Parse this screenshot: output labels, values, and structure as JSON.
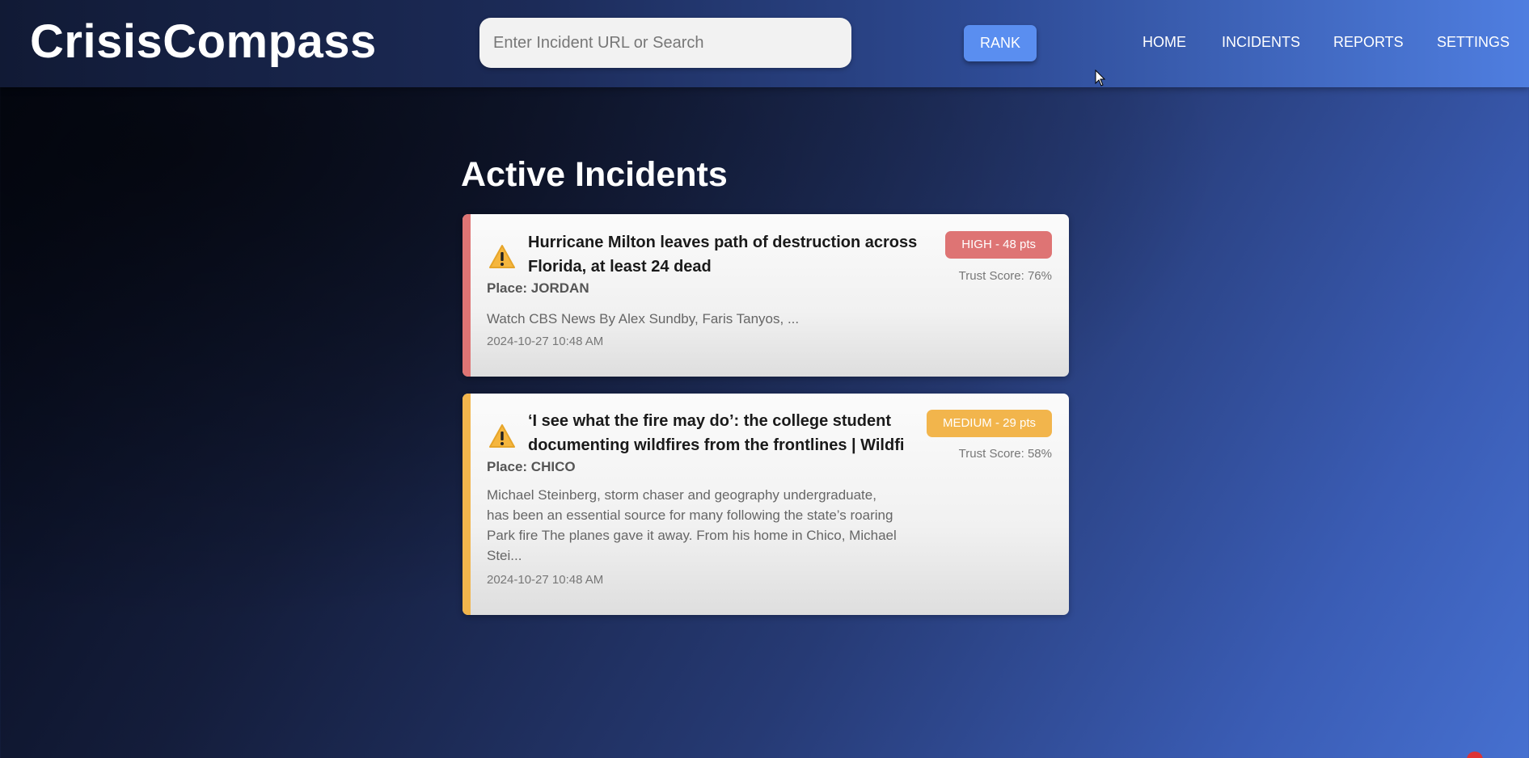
{
  "app": {
    "logo": "CrisisCompass"
  },
  "search": {
    "placeholder": "Enter Incident URL or Search"
  },
  "toolbar": {
    "rank_label": "RANK"
  },
  "nav": {
    "items": [
      {
        "label": "HOME"
      },
      {
        "label": "INCIDENTS"
      },
      {
        "label": "REPORTS"
      },
      {
        "label": "SETTINGS"
      }
    ]
  },
  "main": {
    "title": "Active Incidents",
    "incidents": [
      {
        "icon": "warning-icon",
        "title_line1": "Hurricane Milton leaves path of destruction across",
        "title_line2": "Florida, at least 24 dead",
        "place": "Place: JORDAN",
        "summary": "Watch CBS News By Alex Sundby, Faris Tanyos, ...",
        "timestamp": "2024-10-27 10:48 AM",
        "badge": "HIGH - 48 pts",
        "trust": "Trust Score: 76%",
        "severity_color": "#de7474"
      },
      {
        "icon": "warning-icon",
        "title_line1": "‘I see what the fire may do’: the college student",
        "title_line2": "documenting wildfires from the frontlines | Wildfi",
        "place": "Place: CHICO",
        "summary_lines": [
          "Michael Steinberg, storm chaser and geography undergraduate,",
          "has been an essential source for many following the state’s roaring",
          "Park fire The planes gave it away. From his home in Chico, Michael",
          "Stei..."
        ],
        "timestamp": "2024-10-27 10:48 AM",
        "badge": "MEDIUM - 29 pts",
        "trust": "Trust Score: 58%",
        "severity_color": "#f2b54c"
      }
    ]
  }
}
